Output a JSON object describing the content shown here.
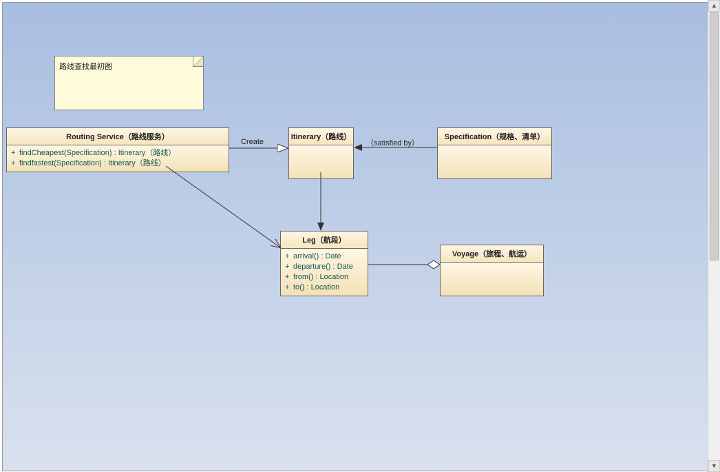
{
  "note": {
    "text": "路线查找最初图"
  },
  "classes": {
    "routingService": {
      "title": "Routing Service（路线服务）",
      "ops": [
        "findCheapest(Specification) : Itinerary（路线）",
        "findfastest(Specification) : Itinerary（路线）"
      ]
    },
    "itinerary": {
      "title": "Itinerary（路线）"
    },
    "specification": {
      "title": "Specification（规格、清单）"
    },
    "leg": {
      "title": "Leg（航段）",
      "ops": [
        "arrival() : Date",
        "departure() : Date",
        "from() : Location",
        "to() : Location"
      ]
    },
    "voyage": {
      "title": "Voyage（旅程、航运）"
    }
  },
  "edges": {
    "create": "Create",
    "satisfiedBy": "（satisfied by）"
  },
  "visibility": "+"
}
